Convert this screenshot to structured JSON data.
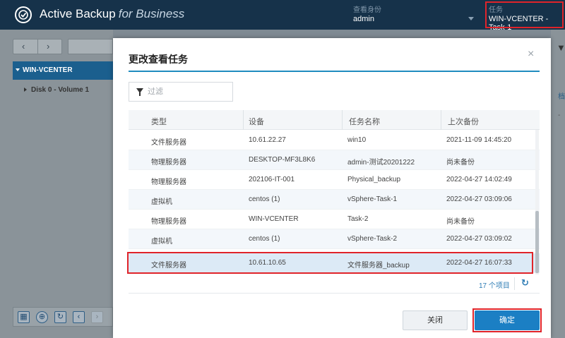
{
  "app": {
    "title": "Active Backup",
    "subtitle": "for Business"
  },
  "header": {
    "view_as_label": "查看身份",
    "view_as_value": "admin",
    "task_label": "任务",
    "task_value": "WIN-VCENTER - Task-1"
  },
  "sidebar": {
    "nav_prev": "‹",
    "nav_next": "›",
    "tree_root": "WIN-VCENTER",
    "tree_child": "Disk 0 - Volume 1"
  },
  "bottom_toolbar": {
    "icons": [
      "calendar-icon",
      "target-icon",
      "refresh-icon",
      "chevron-left-icon",
      "chevron-right-icon"
    ]
  },
  "right_edge": {
    "text1": "档",
    "text2": "-"
  },
  "modal": {
    "title": "更改查看任务",
    "close": "×",
    "filter_placeholder": "过滤",
    "columns": [
      "类型",
      "设备",
      "任务名称",
      "上次备份"
    ],
    "rows": [
      {
        "type": "文件服务器",
        "device": "10.61.22.27",
        "task": "win10",
        "last": "2021-11-09 14:45:20"
      },
      {
        "type": "物理服务器",
        "device": "DESKTOP-MF3L8K6",
        "task": "admin-测试20201222",
        "last": "尚未备份"
      },
      {
        "type": "物理服务器",
        "device": "202106-IT-001",
        "task": "Physical_backup",
        "last": "2022-04-27 14:02:49"
      },
      {
        "type": "虚拟机",
        "device": "centos (1)",
        "task": "vSphere-Task-1",
        "last": "2022-04-27 03:09:06"
      },
      {
        "type": "物理服务器",
        "device": "WIN-VCENTER",
        "task": "Task-2",
        "last": "尚未备份"
      },
      {
        "type": "虚拟机",
        "device": "centos (1)",
        "task": "vSphere-Task-2",
        "last": "2022-04-27 03:09:02"
      },
      {
        "type": "文件服务器",
        "device": "10.61.10.65",
        "task": "文件服务器_backup",
        "last": "2022-04-27 16:07:33"
      }
    ],
    "item_count": "17 个项目",
    "refresh": "↻",
    "close_button": "关闭",
    "ok_button": "确定"
  },
  "colors": {
    "header_bg": "#16324a",
    "accent": "#1b7fc4",
    "highlight": "#e0242a",
    "tree_selected": "#1b5f8e"
  }
}
